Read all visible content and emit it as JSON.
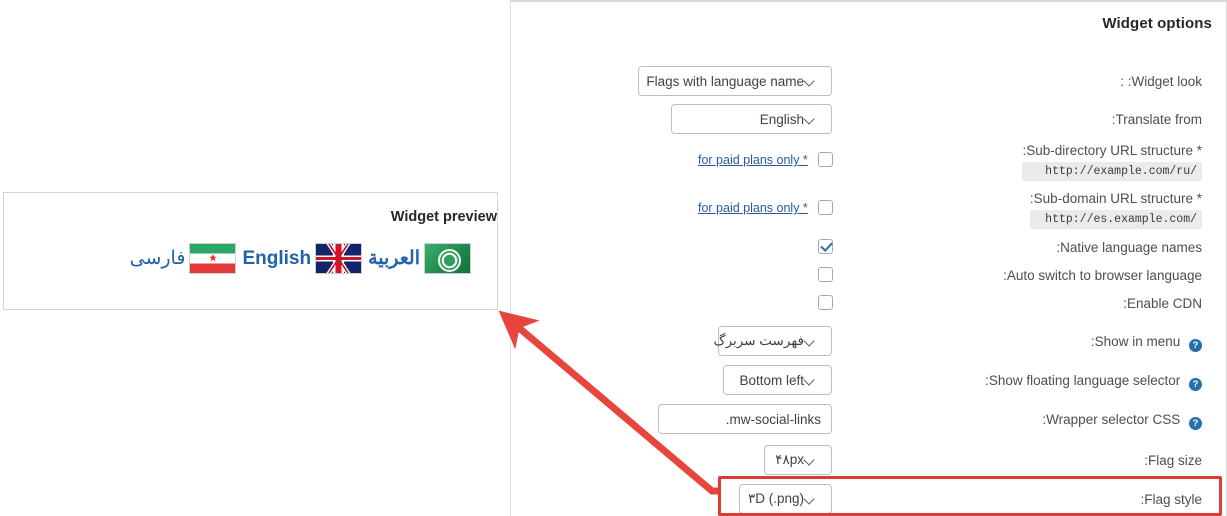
{
  "panel": {
    "title": "Widget options",
    "rows": [
      {
        "label": "Widget look",
        "control": "select",
        "value": "Flags with language name"
      },
      {
        "label": "Translate from",
        "control": "select",
        "value": "English"
      },
      {
        "label": "Sub-directory URL structure *",
        "sublabel": "http://example.com/ru/",
        "control": "checkbox",
        "checked": false,
        "link": "for paid plans only *"
      },
      {
        "label": "Sub-domain URL structure *",
        "sublabel": "http://es.example.com/",
        "control": "checkbox",
        "checked": false,
        "link": "for paid plans only *"
      },
      {
        "label": "Native language names",
        "control": "checkbox",
        "checked": true
      },
      {
        "label": "Auto switch to browser language",
        "control": "checkbox",
        "checked": false
      },
      {
        "label": "Enable CDN",
        "control": "checkbox",
        "checked": false
      },
      {
        "label": "Show in menu",
        "help": true,
        "control": "select",
        "value": "فهرست سربرگ"
      },
      {
        "label": "Show floating language selector",
        "help": true,
        "control": "select",
        "value": "Bottom left"
      },
      {
        "label": "Wrapper selector CSS",
        "help": true,
        "control": "text",
        "value": "mw-social-links."
      },
      {
        "label": "Flag size",
        "control": "select",
        "value": "۴۸px"
      },
      {
        "label": "Flag style",
        "control": "select",
        "value": "۳D (.png)",
        "highlighted": true
      }
    ],
    "help_glyph": "?",
    "accent_color": "#2271a8",
    "highlight_color": "#e03a35"
  },
  "preview": {
    "title": "Widget preview",
    "items": [
      {
        "name": "فارسی",
        "flag": "iran-flag",
        "rtl": true
      },
      {
        "name": "English",
        "flag": "uk-flag",
        "rtl": false
      },
      {
        "name": "العربية",
        "flag": "arab-league-flag",
        "rtl": true
      }
    ]
  },
  "annotation": {
    "arrow_color": "#e8453c",
    "description": "arrow-from-flag-style-to-preview"
  }
}
